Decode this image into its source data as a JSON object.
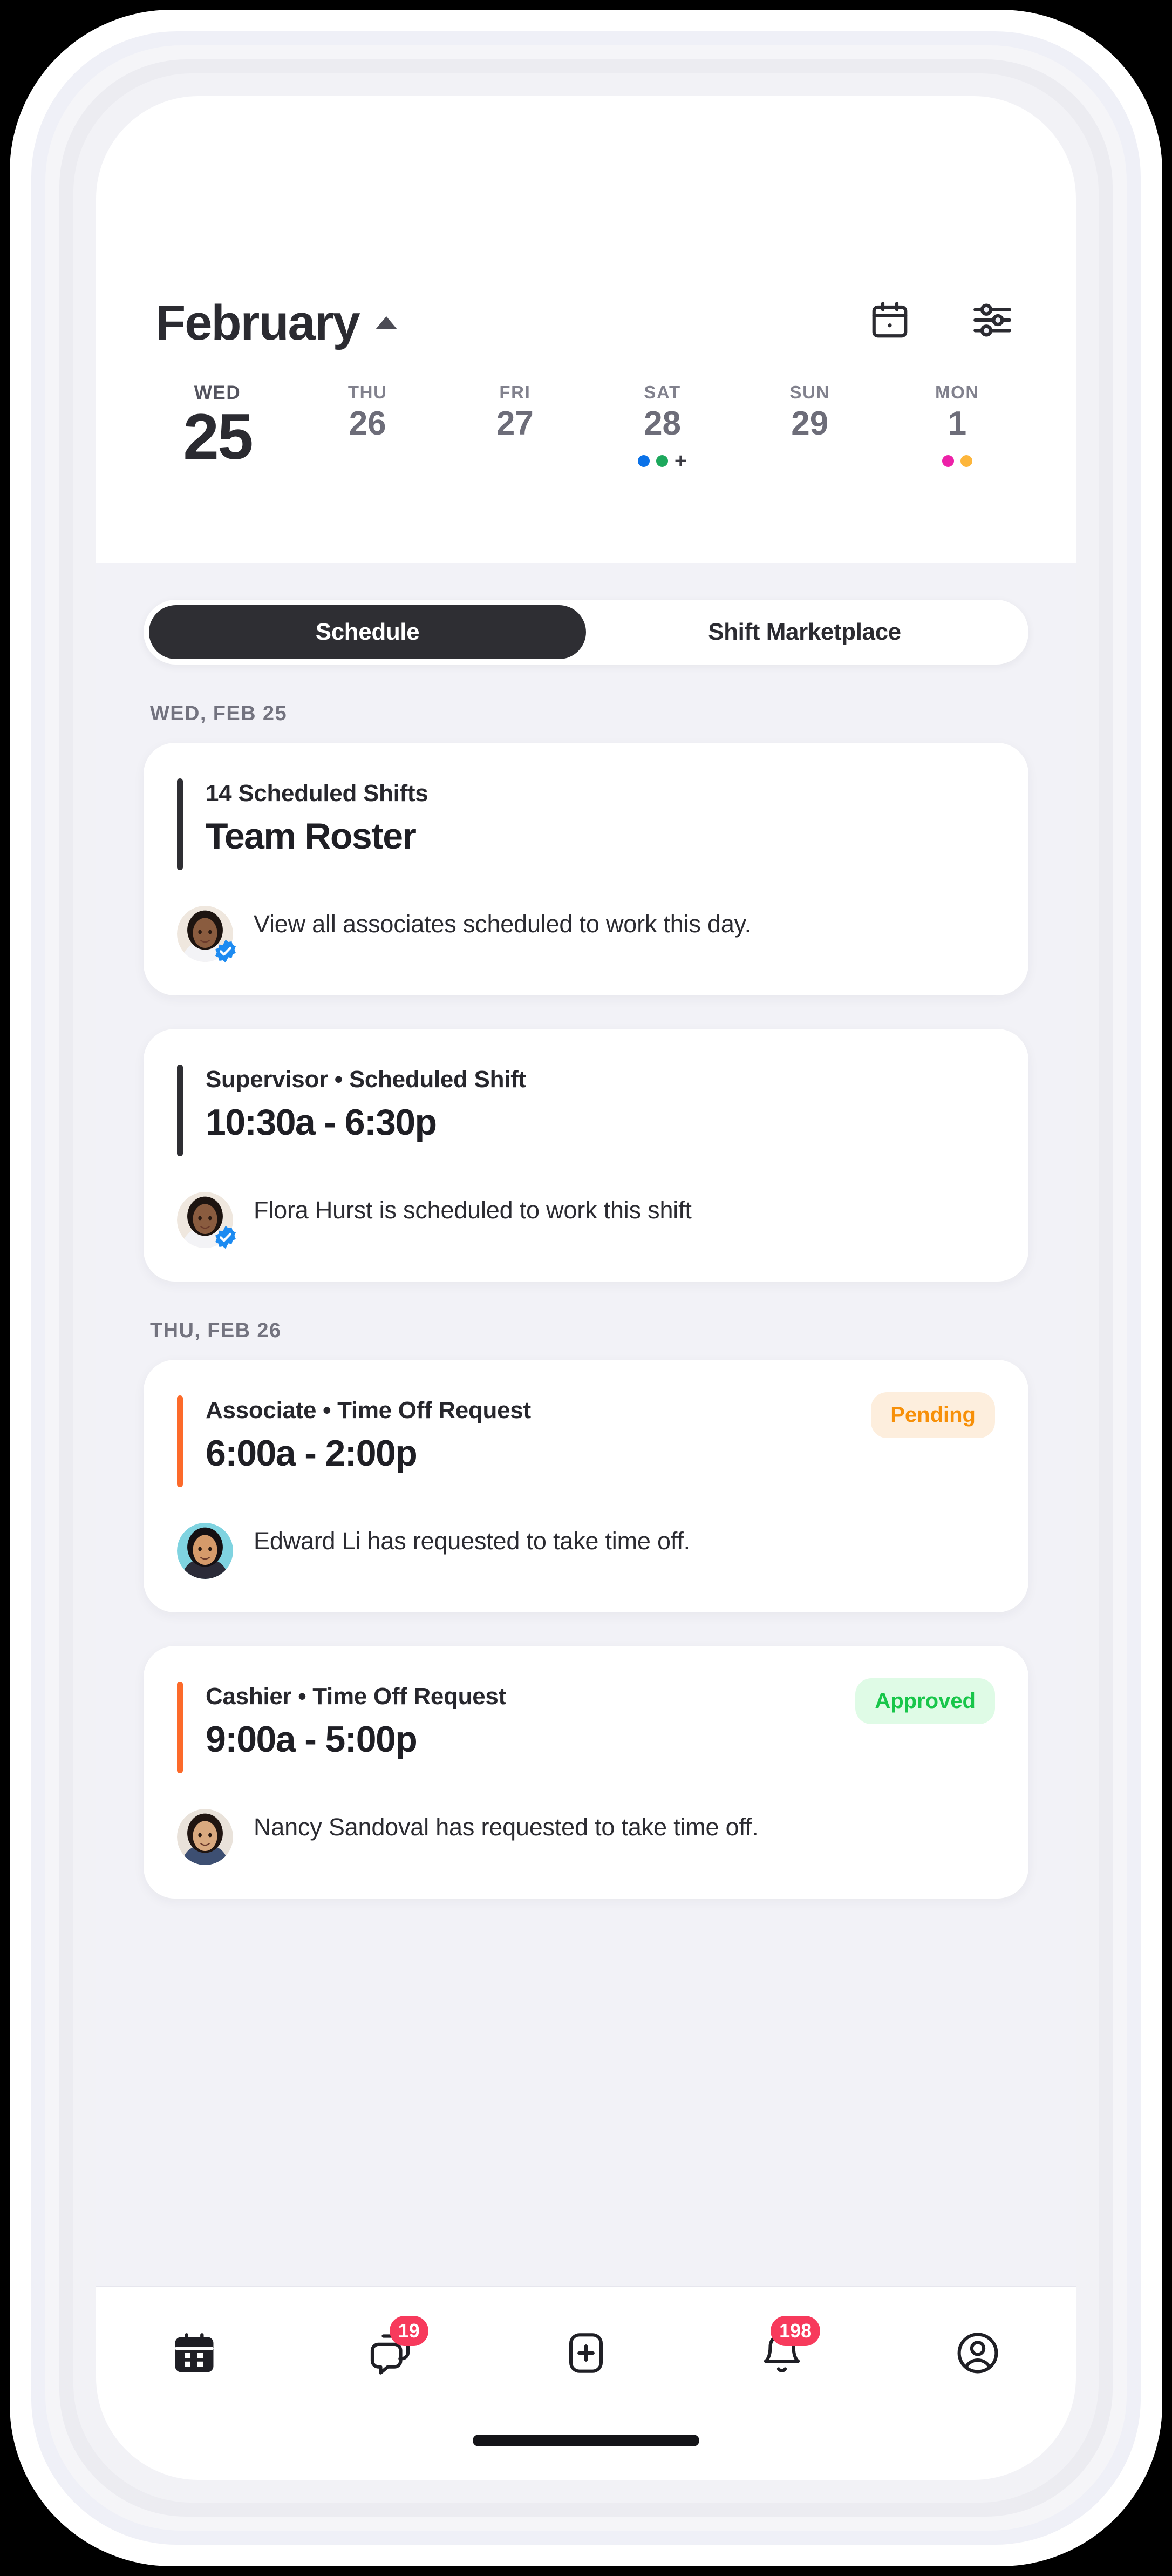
{
  "header": {
    "month": "February",
    "caret_icon": "caret-up-icon",
    "calendar_icon": "calendar-icon",
    "filter_icon": "sliders-filter-icon"
  },
  "date_strip": [
    {
      "dow": "WED",
      "day": "25",
      "selected": true,
      "dots": []
    },
    {
      "dow": "THU",
      "day": "26",
      "selected": false,
      "dots": []
    },
    {
      "dow": "FRI",
      "day": "27",
      "selected": false,
      "dots": []
    },
    {
      "dow": "SAT",
      "day": "28",
      "selected": false,
      "dots": [
        "#0b72e8",
        "#1ca85c"
      ],
      "plus": "+"
    },
    {
      "dow": "SUN",
      "day": "29",
      "selected": false,
      "dots": []
    },
    {
      "dow": "MON",
      "day": "1",
      "selected": false,
      "dots": [
        "#ed21a8",
        "#fdb63c"
      ]
    }
  ],
  "tabs": [
    {
      "label": "Schedule",
      "active": true
    },
    {
      "label": "Shift Marketplace",
      "active": false
    }
  ],
  "sections": [
    {
      "label": "WED, FEB 25",
      "cards": [
        {
          "accent": "dark",
          "subtitle": "14 Scheduled Shifts",
          "title": "Team Roster",
          "badge": null,
          "avatar": "flora-hurst-avatar",
          "verified": true,
          "description": "View all associates scheduled to work this day."
        },
        {
          "accent": "dark",
          "subtitle": "Supervisor • Scheduled Shift",
          "title": "10:30a - 6:30p",
          "badge": null,
          "avatar": "flora-hurst-avatar",
          "verified": true,
          "description": "Flora Hurst is scheduled to work this shift"
        }
      ]
    },
    {
      "label": "THU, FEB 26",
      "cards": [
        {
          "accent": "orange",
          "subtitle": "Associate • Time Off Request",
          "title": "6:00a - 2:00p",
          "badge": {
            "text": "Pending",
            "style": "pending"
          },
          "avatar": "edward-li-avatar",
          "verified": false,
          "description": "Edward Li has requested to take time off."
        },
        {
          "accent": "orange",
          "subtitle": "Cashier • Time Off Request",
          "title": "9:00a - 5:00p",
          "badge": {
            "text": "Approved",
            "style": "approved"
          },
          "avatar": "nancy-sandoval-avatar",
          "verified": false,
          "description": "Nancy Sandoval has requested to take time off."
        }
      ]
    }
  ],
  "bottom_nav": [
    {
      "icon": "calendar-icon",
      "badge": null,
      "active": true
    },
    {
      "icon": "chat-bubbles-icon",
      "badge": "19",
      "active": false
    },
    {
      "icon": "plus-square-icon",
      "badge": null,
      "active": false
    },
    {
      "icon": "bell-icon",
      "badge": "198",
      "active": false
    },
    {
      "icon": "profile-circle-icon",
      "badge": null,
      "active": false
    }
  ],
  "colors": {
    "accent_dark": "#2e2e33",
    "accent_orange": "#fc6a2a",
    "badge_pending_text": "#f79009",
    "badge_pending_bg": "#fdeedd",
    "badge_approved_text": "#18c64a",
    "badge_approved_bg": "#dffbe6",
    "nav_badge": "#f73a5c",
    "verified_blue": "#1d8bf1",
    "screen_bg": "#f2f2f7"
  }
}
